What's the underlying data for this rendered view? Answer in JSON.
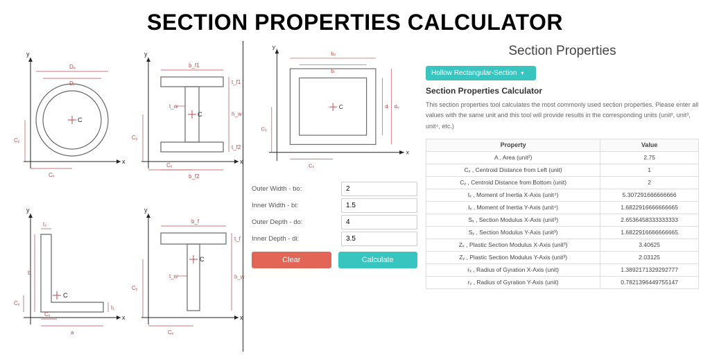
{
  "title": "SECTION PROPERTIES CALCULATOR",
  "right": {
    "heading": "Section Properties",
    "selector_label": "Hollow Rectangular-Section",
    "sub_heading": "Section Properties Calculator",
    "desc_plain": "This section properties tool calculates the most commonly used section properties. Please enter all values with the same unit and this tool will provide results in the corresponding units (unit², unit³, unit⁴, etc.)",
    "th_property": "Property",
    "th_value": "Value",
    "rows": [
      {
        "p": "A , Area (unit²)",
        "v": "2.75"
      },
      {
        "p": "Cₓ , Centroid Distance from Left (unit)",
        "v": "1"
      },
      {
        "p": "Cᵧ , Centroid Distance from Bottom (unit)",
        "v": "2"
      },
      {
        "p": "Iₓ , Moment of Inertia X-Axis (unit⁴)",
        "v": "5.307291666666666"
      },
      {
        "p": "Iᵧ , Moment of Inertia Y-Axis (unit⁴)",
        "v": "1.6822916666666665"
      },
      {
        "p": "Sₓ , Section Modulus X-Axis (unit³)",
        "v": "2.6536458333333333"
      },
      {
        "p": "Sᵧ , Section Modulus Y-Axis (unit³)",
        "v": "1.6822916666666665"
      },
      {
        "p": "Zₓ , Plastic Section Modulus X-Axis (unit³)",
        "v": "3.40625"
      },
      {
        "p": "Zᵧ , Plastic Section Modulus Y-Axis (unit³)",
        "v": "2.03125"
      },
      {
        "p": "rₓ , Radius of Gyration X-Axis (unit)",
        "v": "1.3892171329292777"
      },
      {
        "p": "rᵧ , Radius of Gyration Y-Axis (unit)",
        "v": "0.7821396449755147"
      }
    ]
  },
  "form": {
    "fields": [
      {
        "label": "Outer Width - bo:",
        "value": "2"
      },
      {
        "label": "Inner Width - bi:",
        "value": "1.5"
      },
      {
        "label": "Outer Depth - do:",
        "value": "4"
      },
      {
        "label": "Inner Depth - di:",
        "value": "3.5"
      }
    ],
    "clear": "Clear",
    "calculate": "Calculate"
  },
  "diagrams": {
    "annotations": {
      "hollow_circle": [
        "Dₒ",
        "Dᵢ",
        "C",
        "Cᵧ",
        "Cₓ",
        "x",
        "y"
      ],
      "i_beam": [
        "b_f1",
        "t_f1",
        "t_w",
        "h_w",
        "t_f2",
        "b_f2",
        "Cₓ",
        "Cᵧ",
        "C",
        "x",
        "y"
      ],
      "angle": [
        "t₂",
        "b",
        "t₁",
        "a",
        "Cₓ",
        "Cᵧ",
        "C",
        "x",
        "y"
      ],
      "tee": [
        "b_f",
        "t_f",
        "t_w",
        "h_w",
        "Cₓ",
        "Cᵧ",
        "C",
        "x",
        "y"
      ],
      "hollow_rect": [
        "bₒ",
        "bᵢ",
        "dᵢ",
        "dₒ",
        "Cₓ",
        "Cᵧ",
        "C",
        "x",
        "y"
      ]
    }
  }
}
